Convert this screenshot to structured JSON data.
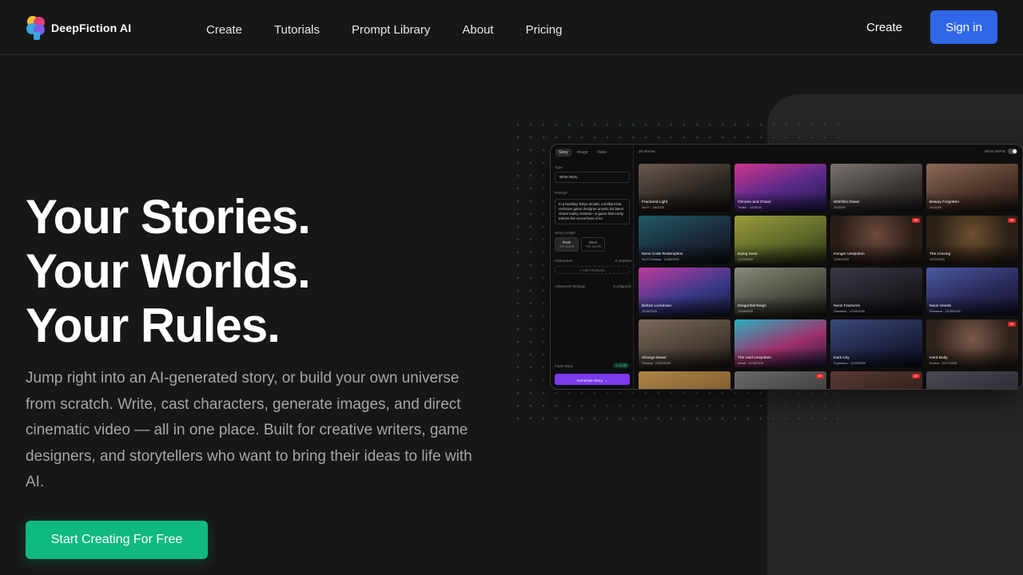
{
  "brand": {
    "name": "DeepFiction AI"
  },
  "nav": {
    "links": [
      "Create",
      "Tutorials",
      "Prompt Library",
      "About",
      "Pricing"
    ],
    "create": "Create",
    "signin": "Sign in"
  },
  "hero": {
    "title_lines": [
      "Your Stories.",
      "Your Worlds.",
      "Your Rules."
    ],
    "description": "Jump right into an AI-generated story, or build your own universe from scratch. Write, cast characters, generate images, and direct cinematic video — all in one place. Built for creative writers, game designers, and storytellers who want to bring their ideas to life with AI.",
    "cta": "Start Creating For Free"
  },
  "app": {
    "tabs": [
      "Story",
      "Image",
      "Video"
    ],
    "type_label": "Type",
    "type_value": "Write Story",
    "prompt_label": "Prompt*",
    "prompt_text": "In a bustling Tokyo arcade, a brilliant but reclusive game designer unveils his latest virtual reality creation—a game that eerily mirrors the secret lives of its",
    "length_label": "Story Length",
    "length_options": [
      {
        "name": "Flash",
        "sub": "~50 words"
      },
      {
        "name": "Short",
        "sub": "~5K words"
      }
    ],
    "characters_label": "Characters",
    "characters_action": "AI Explore",
    "add_character": "+ Add Character",
    "advanced_label": "Advanced Settings",
    "advanced_state": "Configured",
    "flash_story": "Flash Story",
    "credit": "1 credit",
    "generate": "Generate Story →",
    "count": "20 stories",
    "nsfw": "Show NSFW",
    "stories": [
      {
        "title": "Fractured Light",
        "meta": "Sci-Fi · 1/5/2026",
        "badge": ""
      },
      {
        "title": "Chrome and Chaos",
        "meta": "Thriller · 1/3/2026",
        "badge": ""
      },
      {
        "title": "Witchfire Dawn",
        "meta": "1/2/2026",
        "badge": ""
      },
      {
        "title": "Beauty Forgotten",
        "meta": "1/1/2026",
        "badge": ""
      },
      {
        "title": "Neon Code Redemption",
        "meta": "Sci-Fi Fantasy · 12/30/2025",
        "badge": ""
      },
      {
        "title": "Dying Suns",
        "meta": "12/29/2025",
        "badge": ""
      },
      {
        "title": "Hunger Unspoken",
        "meta": "12/30/2025",
        "badge": "18+"
      },
      {
        "title": "The Craving",
        "meta": "12/29/2025",
        "badge": "18+"
      },
      {
        "title": "Before Lockdown",
        "meta": "12/28/2025",
        "badge": ""
      },
      {
        "title": "Dragonfall Reign",
        "meta": "12/28/2025",
        "badge": ""
      },
      {
        "title": "Neon Fractures",
        "meta": "Fanfiction · 12/28/2025",
        "badge": ""
      },
      {
        "title": "Neon Hearts",
        "meta": "Romance · 12/28/2025",
        "badge": ""
      },
      {
        "title": "Strange Beast",
        "meta": "Fantasy · 12/28/2025",
        "badge": ""
      },
      {
        "title": "The Void Unspoken",
        "meta": "Isekai · 12/28/2025",
        "badge": ""
      },
      {
        "title": "Dark City",
        "meta": "Superhero · 12/28/2025",
        "badge": ""
      },
      {
        "title": "Hard Body",
        "meta": "Erotica · 12/27/2025",
        "badge": "18+"
      },
      {
        "title": "",
        "meta": "",
        "badge": ""
      },
      {
        "title": "",
        "meta": "",
        "badge": "18+"
      },
      {
        "title": "",
        "meta": "",
        "badge": "18+"
      },
      {
        "title": "",
        "meta": "",
        "badge": ""
      }
    ]
  },
  "colors": {
    "accent_blue": "#2f67e8",
    "accent_green": "#10b981",
    "accent_purple": "#7c3aed"
  }
}
